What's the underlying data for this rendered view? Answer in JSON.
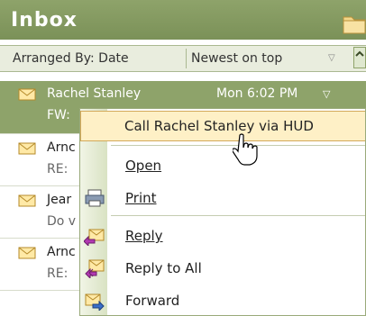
{
  "pane": {
    "title": "Inbox"
  },
  "arrange": {
    "by_label": "Arranged By: Date",
    "order_label": "Newest on top"
  },
  "messages": [
    {
      "sender": "Rachel Stanley",
      "date": "Mon 6:02 PM",
      "subject": "FW:",
      "selected": true
    },
    {
      "sender": "Arnc",
      "date": "",
      "subject": "RE:",
      "selected": false
    },
    {
      "sender": "Jear",
      "date": "",
      "subject": "Do v",
      "selected": false
    },
    {
      "sender": "Arnc",
      "date": "",
      "subject": "RE:",
      "selected": false
    }
  ],
  "context_menu": {
    "items": [
      {
        "label": "Call Rachel Stanley via HUD",
        "icon": ""
      },
      {
        "label": "Open",
        "icon": ""
      },
      {
        "label": "Print",
        "icon": "printer-icon"
      },
      {
        "label": "Reply",
        "icon": "reply-icon"
      },
      {
        "label": "Reply to All",
        "icon": "reply-all-icon"
      },
      {
        "label": "Forward",
        "icon": "forward-icon"
      }
    ]
  },
  "colors": {
    "accent": "#8ea36a",
    "highlight": "#fef0c6"
  }
}
